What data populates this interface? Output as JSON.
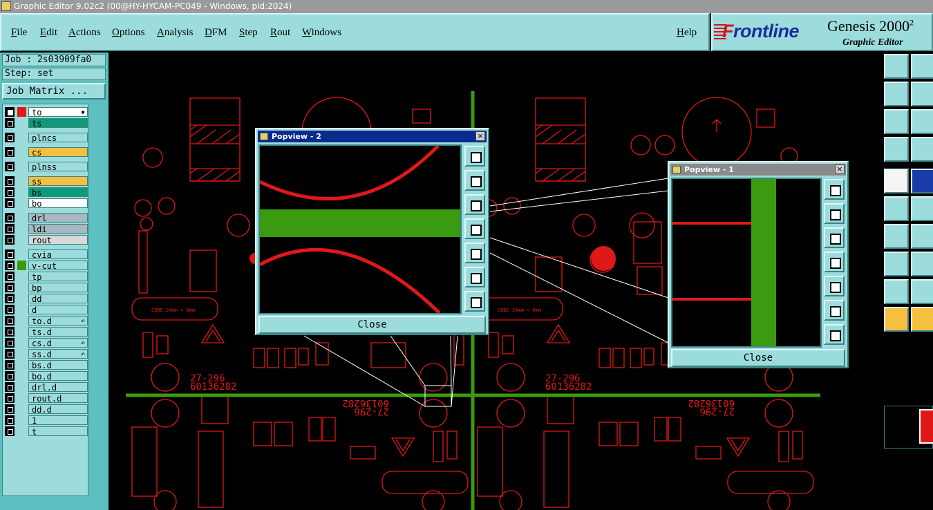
{
  "window": {
    "title": "Graphic Editor 9.02c2 (00@HY-HYCAM-PC049 - Windows, pid:2024)"
  },
  "menu": {
    "file": "File",
    "edit": "Edit",
    "actions": "Actions",
    "options": "Options",
    "analysis": "Analysis",
    "dfm": "DFM",
    "step": "Step",
    "rout": "Rout",
    "windows": "Windows",
    "help": "Help"
  },
  "logo": {
    "brand": "rontline",
    "brand_initial": "F",
    "product": "Genesis 2000",
    "product_sup": "2",
    "subtitle": "Graphic Editor"
  },
  "job": {
    "job_line": "Job : 2s03909fa0",
    "step_line": "Step: set",
    "matrix_button": "Job Matrix ..."
  },
  "layers": [
    {
      "name": "to",
      "bg": "#ffffff",
      "swatch": "#e01818",
      "checked": true,
      "mark": "▪"
    },
    {
      "name": "ts",
      "bg": "#0e9a78",
      "swatch": "",
      "checked": false,
      "mark": ""
    },
    {
      "name": "plncs",
      "bg": "#9cdcdc",
      "swatch": "",
      "checked": false,
      "mark": ""
    },
    {
      "name": "cs",
      "bg": "#f5c040",
      "swatch": "",
      "checked": false,
      "mark": ""
    },
    {
      "name": "plnss",
      "bg": "#9cdcdc",
      "swatch": "",
      "checked": false,
      "mark": ""
    },
    {
      "name": "ss",
      "bg": "#f5c040",
      "swatch": "",
      "checked": false,
      "mark": ""
    },
    {
      "name": "bs",
      "bg": "#0e9a78",
      "swatch": "",
      "checked": false,
      "mark": ""
    },
    {
      "name": "bo",
      "bg": "#ffffff",
      "swatch": "",
      "checked": false,
      "mark": ""
    },
    {
      "name": "drl",
      "bg": "#a8b8c0",
      "swatch": "",
      "checked": false,
      "mark": ""
    },
    {
      "name": "ldi",
      "bg": "#a8b8c0",
      "swatch": "",
      "checked": false,
      "mark": ""
    },
    {
      "name": "rout",
      "bg": "#d8d8d8",
      "swatch": "",
      "checked": false,
      "mark": ""
    },
    {
      "name": "cvia",
      "bg": "#9cdcdc",
      "swatch": "",
      "checked": false,
      "mark": ""
    },
    {
      "name": "v-cut",
      "bg": "#9cdcdc",
      "swatch": "#3a9a10",
      "checked": false,
      "mark": ""
    },
    {
      "name": "tp",
      "bg": "#9cdcdc",
      "swatch": "",
      "checked": false,
      "mark": ""
    },
    {
      "name": "bp",
      "bg": "#9cdcdc",
      "swatch": "",
      "checked": false,
      "mark": ""
    },
    {
      "name": "dd",
      "bg": "#9cdcdc",
      "swatch": "",
      "checked": false,
      "mark": ""
    },
    {
      "name": "d",
      "bg": "#9cdcdc",
      "swatch": "",
      "checked": false,
      "mark": ""
    },
    {
      "name": "to.d",
      "bg": "#9cdcdc",
      "swatch": "",
      "checked": false,
      "mark": "✍"
    },
    {
      "name": "ts.d",
      "bg": "#9cdcdc",
      "swatch": "",
      "checked": false,
      "mark": ""
    },
    {
      "name": "cs.d",
      "bg": "#9cdcdc",
      "swatch": "",
      "checked": false,
      "mark": "✍"
    },
    {
      "name": "ss.d",
      "bg": "#9cdcdc",
      "swatch": "",
      "checked": false,
      "mark": "✍"
    },
    {
      "name": "bs.d",
      "bg": "#9cdcdc",
      "swatch": "",
      "checked": false,
      "mark": ""
    },
    {
      "name": "bo.d",
      "bg": "#9cdcdc",
      "swatch": "",
      "checked": false,
      "mark": ""
    },
    {
      "name": "drl.d",
      "bg": "#9cdcdc",
      "swatch": "",
      "checked": false,
      "mark": ""
    },
    {
      "name": "rout.d",
      "bg": "#9cdcdc",
      "swatch": "",
      "checked": false,
      "mark": ""
    },
    {
      "name": "dd.d",
      "bg": "#9cdcdc",
      "swatch": "",
      "checked": false,
      "mark": ""
    },
    {
      "name": "1",
      "bg": "#9cdcdc",
      "swatch": "",
      "checked": false,
      "mark": ""
    },
    {
      "name": "t",
      "bg": "#9cdcdc",
      "swatch": "",
      "checked": false,
      "mark": ""
    }
  ],
  "popview2": {
    "title": "Popview - 2",
    "close_label": "Close",
    "close_x": "×"
  },
  "popview1": {
    "title": "Popview - 1",
    "close_label": "Close",
    "close_x": "×"
  },
  "board_text": {
    "part_no_top_left": "27-296",
    "code_top_left": "60136282",
    "part_no_top_right": "27-296",
    "code_top_right": "60136282",
    "code_bottom_left": "60136282",
    "part_no_bottom_left": "27-296",
    "code_bottom_right": "60136282",
    "part_no_bottom_right": "27-296",
    "code_box_1": "CODE 24mm × 8mm",
    "code_box_2": "CODE 24mm × 8mm"
  },
  "colors": {
    "trace": "#e01818",
    "vcut": "#3a9a10",
    "panel": "#9cdcdc",
    "panel_dark": "#5cc0c0",
    "title_active": "#0a2a8c",
    "title_inactive": "#8a8a8a"
  }
}
